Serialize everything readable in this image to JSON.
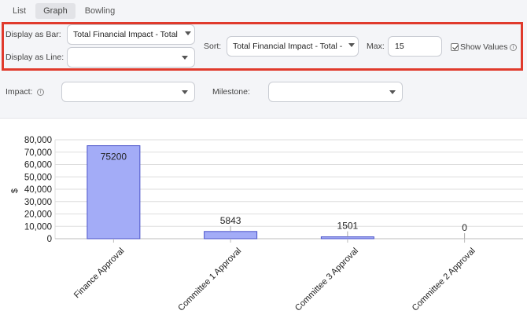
{
  "tabs": [
    {
      "label": "List",
      "active": false
    },
    {
      "label": "Graph",
      "active": true
    },
    {
      "label": "Bowling",
      "active": false
    }
  ],
  "controls": {
    "bar_label": "Display as Bar:",
    "bar_value": "Total Financial Impact - Total",
    "line_label": "Display as Line:",
    "line_value": "",
    "sort_label": "Sort:",
    "sort_value": "Total Financial Impact - Total -",
    "max_label": "Max:",
    "max_value": "15",
    "show_values_label": "Show Values",
    "show_values_checked": true
  },
  "filters": {
    "impact_label": "Impact:",
    "impact_value": "",
    "milestone_label": "Milestone:",
    "milestone_value": ""
  },
  "chart_data": {
    "type": "bar",
    "categories": [
      "Finance Approval",
      "Committee 1 Approval",
      "Committee 3 Approval",
      "Committee 2 Approval"
    ],
    "values": [
      75200,
      5843,
      1501,
      0
    ],
    "value_labels": [
      "75200",
      "5843",
      "1501",
      "0"
    ],
    "ylabel": "$",
    "ylim": [
      0,
      80000
    ],
    "yticks": [
      "0",
      "10,000",
      "20,000",
      "30,000",
      "40,000",
      "50,000",
      "60,000",
      "70,000",
      "80,000"
    ],
    "ytick_values": [
      0,
      10000,
      20000,
      30000,
      40000,
      50000,
      60000,
      70000,
      80000
    ],
    "grid": true,
    "bar_color": "#a3acf7",
    "bar_stroke": "#4a52c9"
  }
}
